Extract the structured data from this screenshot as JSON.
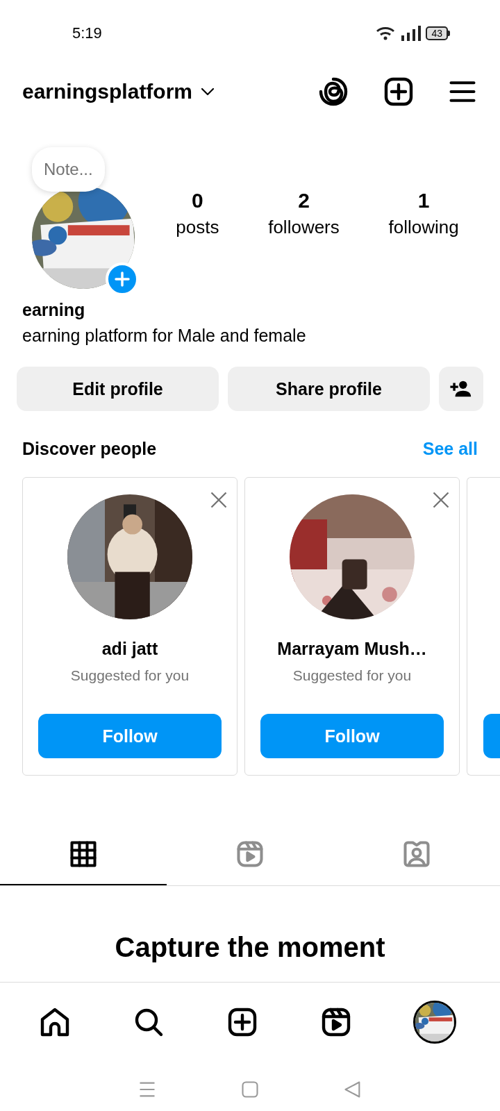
{
  "status_bar": {
    "time": "5:19",
    "battery": "43"
  },
  "header": {
    "username": "earningsplatform"
  },
  "profile": {
    "note": "Note...",
    "stats": [
      {
        "value": "0",
        "label": "posts"
      },
      {
        "value": "2",
        "label": "followers"
      },
      {
        "value": "1",
        "label": "following"
      }
    ],
    "name": "earning",
    "bio": "earning platform for Male and female"
  },
  "actions": [
    "Edit profile",
    "Share profile"
  ],
  "discover": {
    "title": "Discover people",
    "see_all": "See all",
    "cards": [
      {
        "name": "adi jatt",
        "subtitle": "Suggested for you",
        "button": "Follow"
      },
      {
        "name": "Marrayam Mush…",
        "subtitle": "Suggested for you",
        "button": "Follow"
      }
    ]
  },
  "tabs": [
    {
      "kind": "grid",
      "selected": true
    },
    {
      "kind": "reels",
      "selected": false
    },
    {
      "kind": "tagged",
      "selected": false
    }
  ],
  "empty_state": {
    "heading": "Capture the moment"
  },
  "bottom_nav": [
    {
      "kind": "home"
    },
    {
      "kind": "search"
    },
    {
      "kind": "create"
    },
    {
      "kind": "reels"
    },
    {
      "kind": "avatar"
    }
  ]
}
